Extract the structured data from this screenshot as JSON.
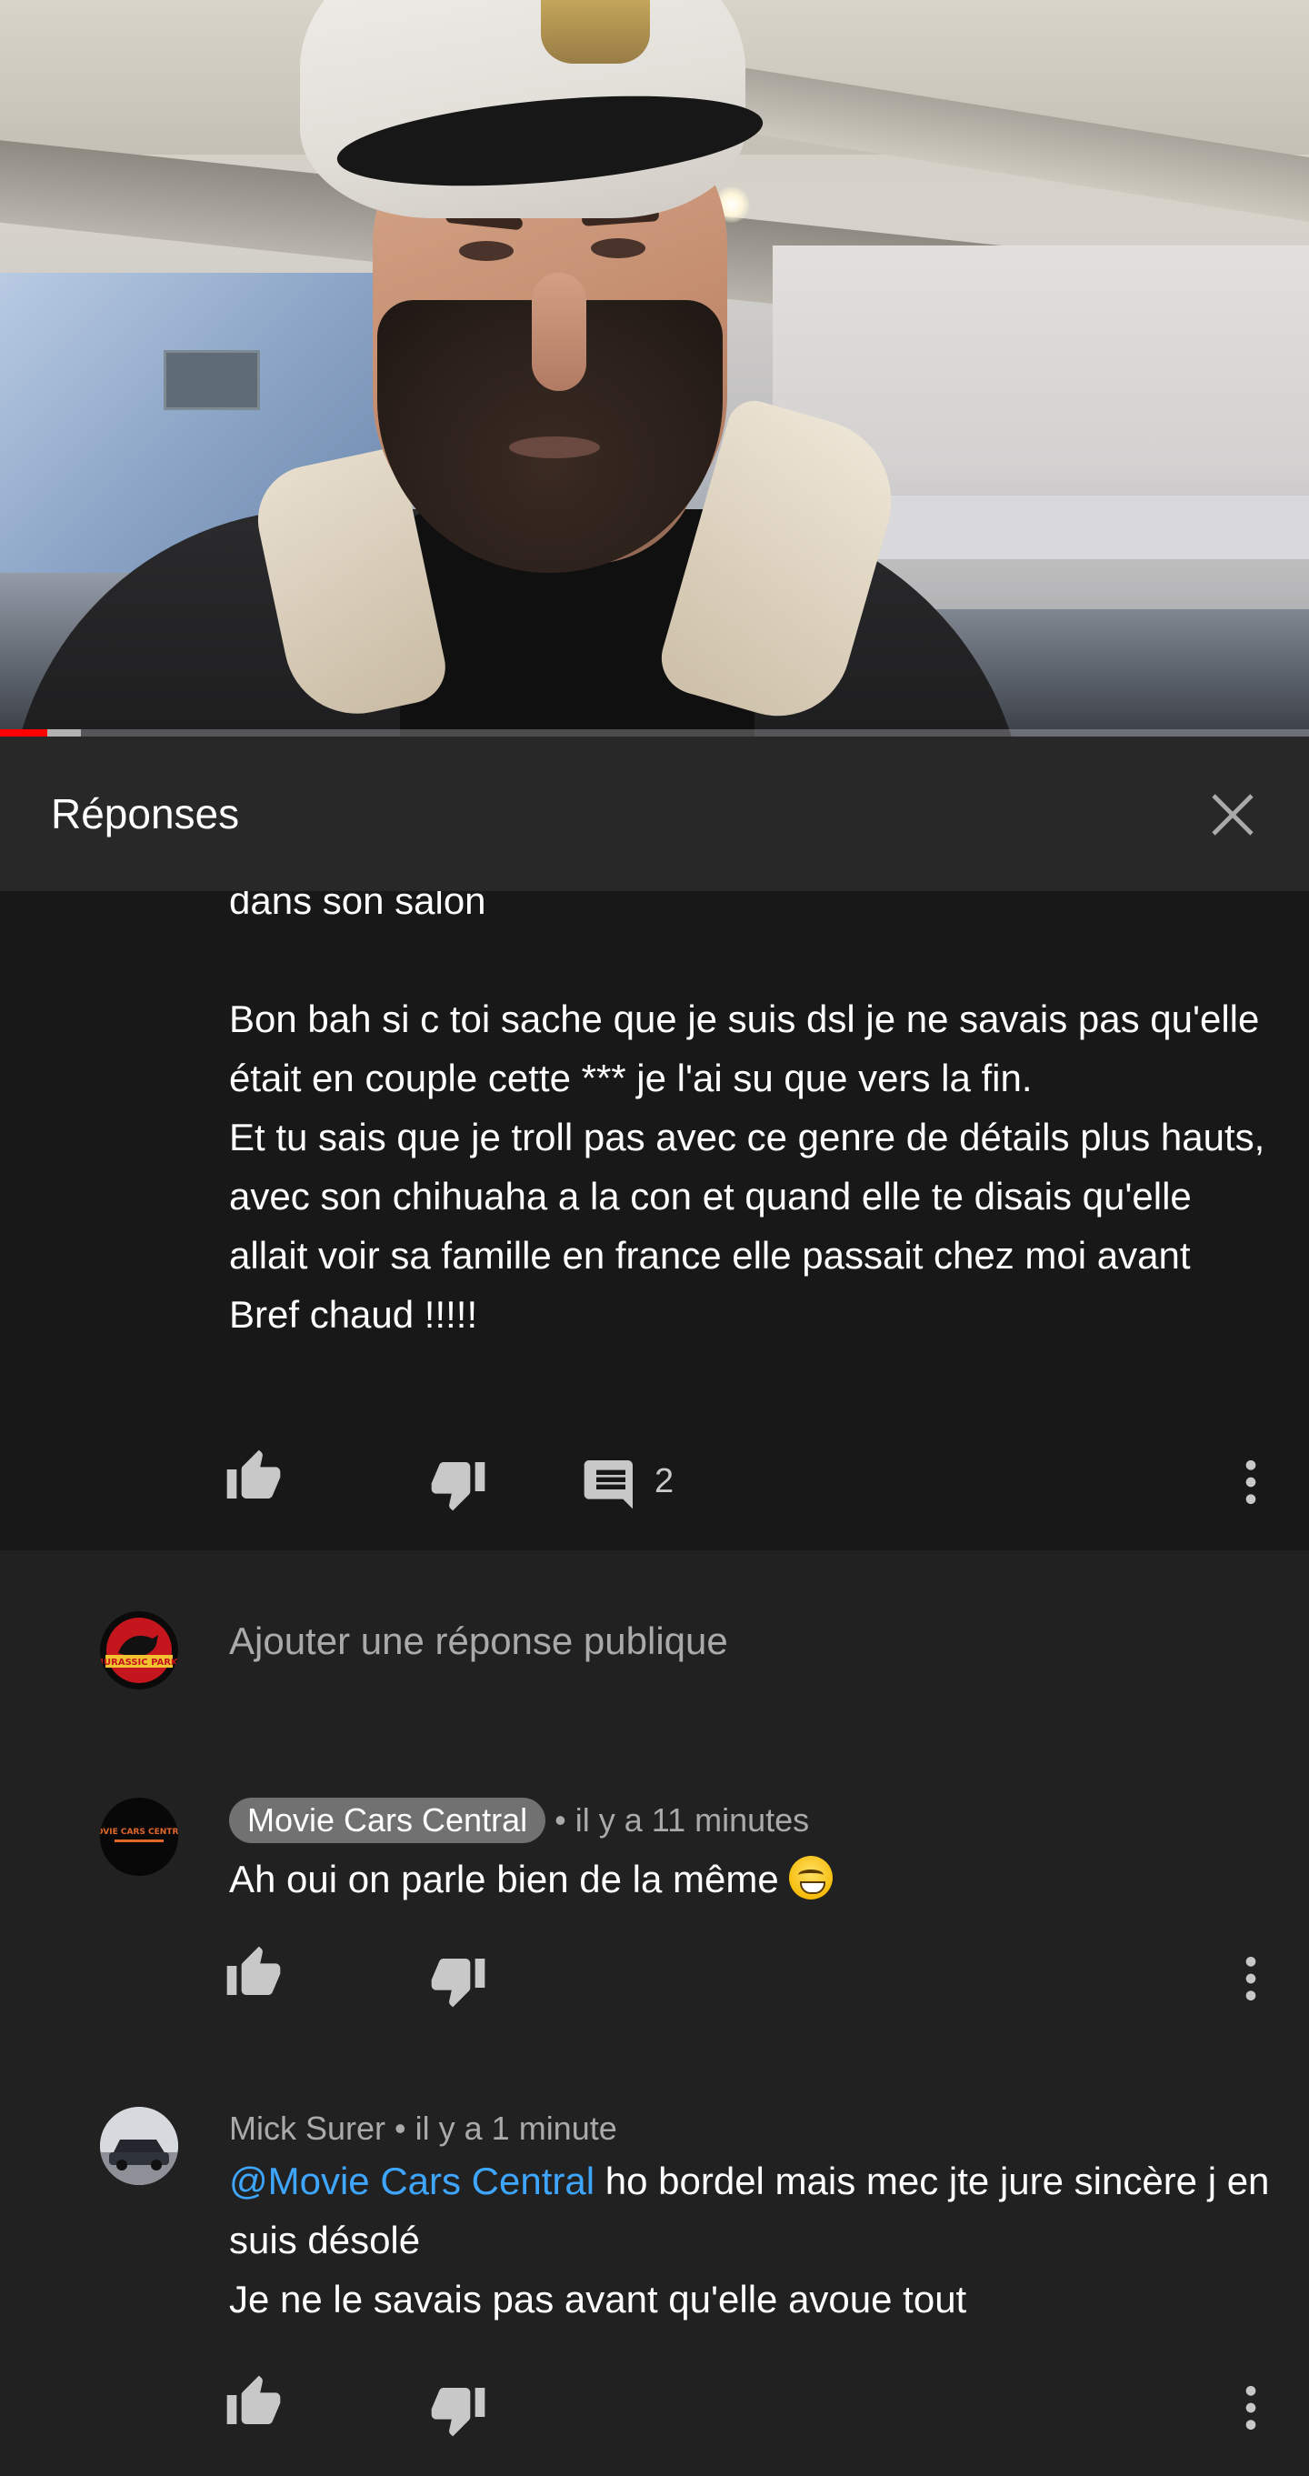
{
  "video": {
    "progress_percent": 3.6,
    "buffered_percent": 6.2
  },
  "panel": {
    "title": "Réponses",
    "close_icon": "close-icon"
  },
  "parent_comment": {
    "text": "dans son salon\n\nBon bah si c toi sache que je suis dsl je ne savais pas qu'elle était en couple cette *** je l'ai su que vers la fin.\nEt tu sais que je troll pas avec ce genre de détails plus hauts, avec son chihuaha a la con et quand elle te disais qu'elle allait voir sa famille en france elle passait chez moi avant\nBref chaud !!!!!",
    "reply_count": "2"
  },
  "reply_input": {
    "placeholder": "Ajouter une réponse publique",
    "avatar_text": "JURASSIC PARK"
  },
  "replies": [
    {
      "author": "Movie Cars Central",
      "time": "• il y a 11 minutes",
      "text": "Ah oui on parle bien de la même",
      "emoji": "grinning-sweat-emoji",
      "avatar_text": "MOVIE CARS CENTRAL"
    },
    {
      "author": "Mick Surer",
      "time": "• il y a 1 minute",
      "mention": "@Movie Cars Central",
      "text": " ho bordel mais mec jte jure sincère j en suis désolé\nJe ne le savais pas avant qu'elle avoue tout"
    }
  ],
  "colors": {
    "background": "#212121",
    "parent_bg": "#181818",
    "header_bg": "#282828",
    "mention": "#3ea6ff",
    "progress": "#ff0000",
    "secondary_text": "#aaaaaa"
  }
}
